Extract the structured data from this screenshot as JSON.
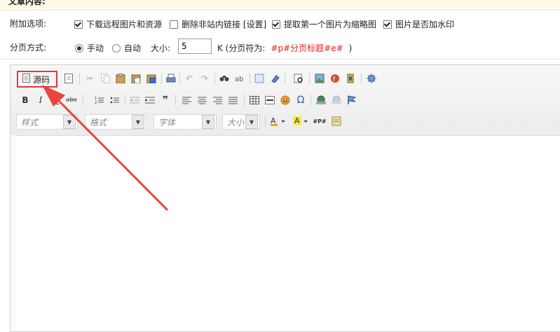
{
  "section": {
    "label_cut": "文章内容:"
  },
  "options_row": {
    "label": "附加选项:",
    "options": [
      {
        "label": "下载远程图片和资源",
        "checked": true
      },
      {
        "label": "删除非站内链接 [设置]",
        "checked": false
      },
      {
        "label": "提取第一个图片为缩略图",
        "checked": true
      },
      {
        "label": "图片是否加水印",
        "checked": true
      }
    ]
  },
  "paging_row": {
    "label": "分页方式:",
    "radio_manual": "手动",
    "radio_auto": "自动",
    "selected": "手动",
    "size_label": "大小:",
    "size_value": "5",
    "unit_prefix": "K (分页符为:",
    "separator_code": "#p#分页标题#e#",
    "unit_suffix": ")"
  },
  "editor": {
    "source_button_label": "源码",
    "combos": {
      "style": "样式",
      "format": "格式",
      "font": "字体",
      "size": "大小"
    },
    "highlight_color": "#e23a3a"
  }
}
